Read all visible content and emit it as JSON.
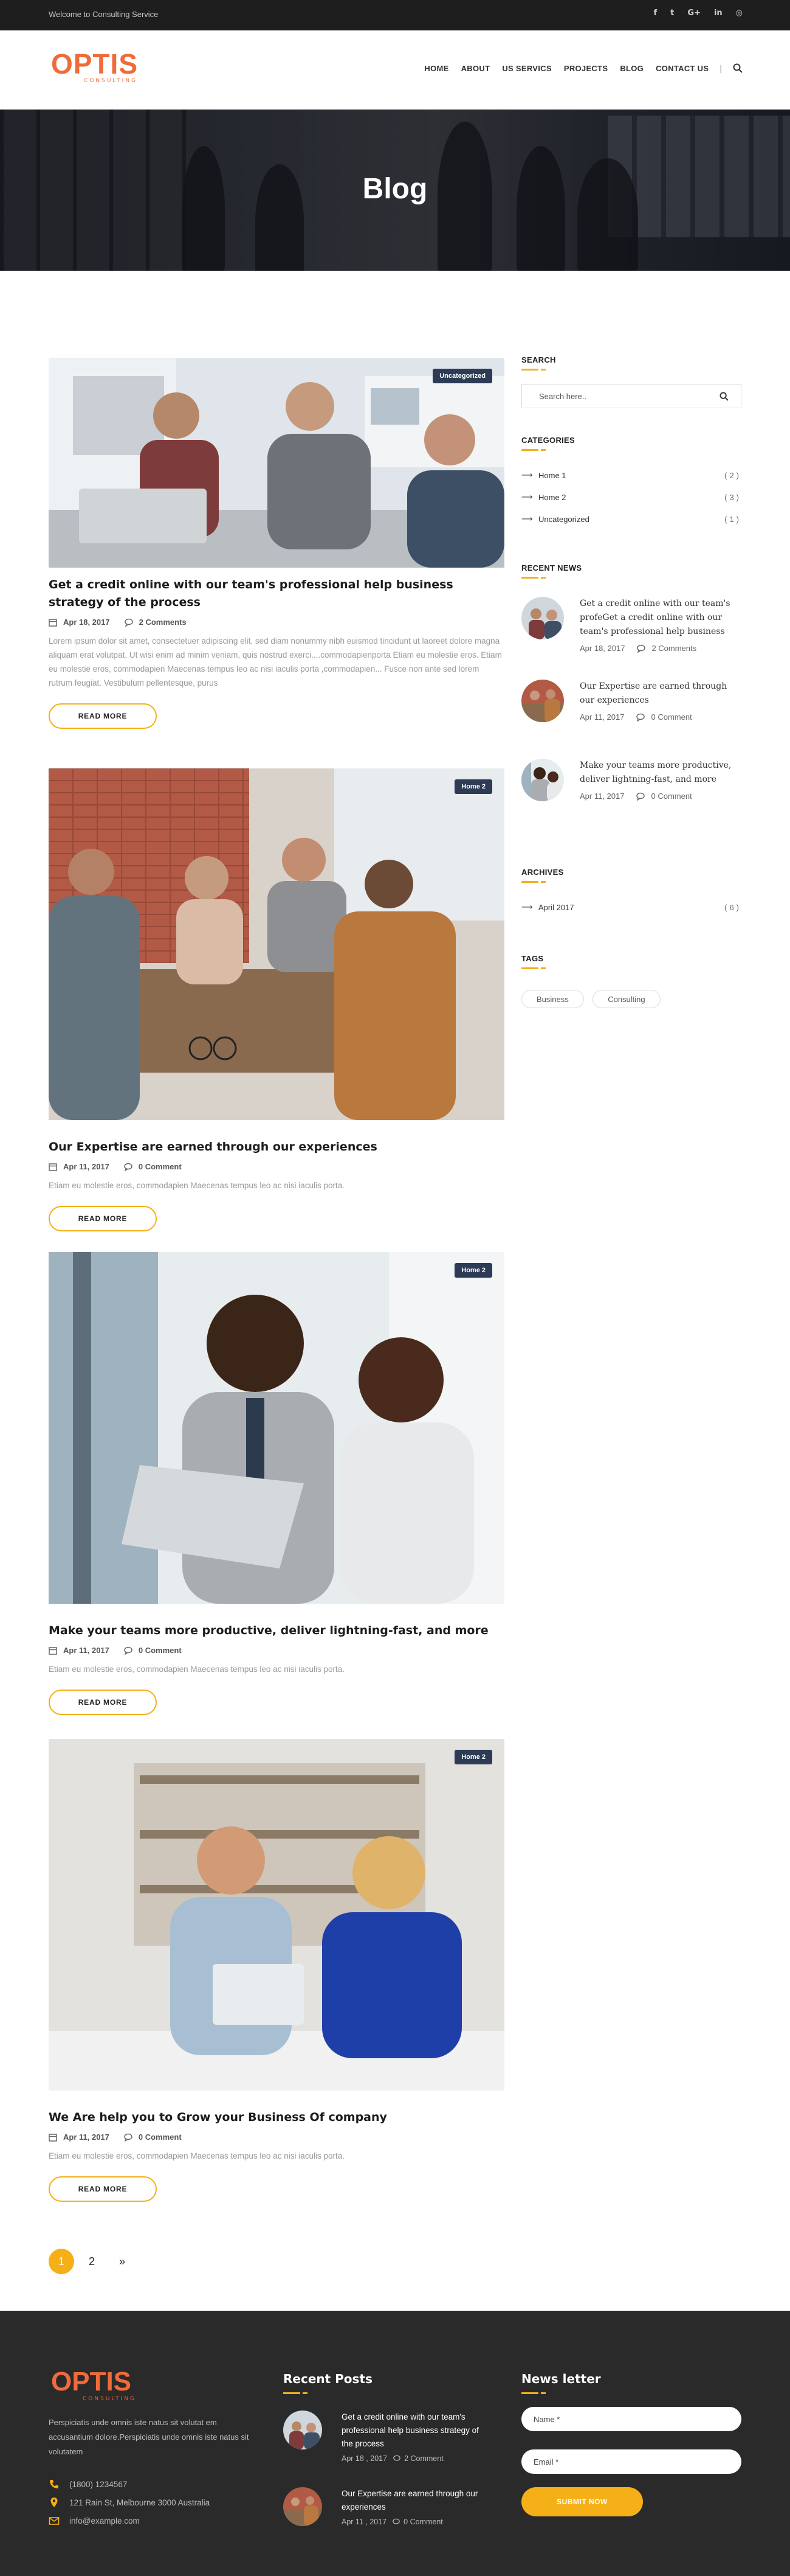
{
  "topbar": {
    "welcome": "Welcome to Consulting Service",
    "socials": [
      {
        "icon": "facebook-icon",
        "glyph": "f"
      },
      {
        "icon": "twitter-icon",
        "glyph": "t"
      },
      {
        "icon": "google-plus-icon",
        "glyph": "G+"
      },
      {
        "icon": "linkedin-icon",
        "glyph": "in"
      },
      {
        "icon": "instagram-icon",
        "glyph": "◎"
      }
    ]
  },
  "header": {
    "logo": {
      "mark": "OPTIS",
      "sub": "CONSULTING"
    },
    "nav": [
      "HOME",
      "ABOUT",
      "US SERVICS",
      "PROJECTS",
      "BLOG",
      "CONTACT US"
    ],
    "nav_separator": "|"
  },
  "hero": {
    "title": "Blog"
  },
  "posts": [
    {
      "badge": "Uncategorized",
      "title": "Get a credit online with our team's professional help business strategy of the process",
      "date": "Apr 18, 2017",
      "comments": "2 Comments",
      "excerpt": "Lorem ipsum dolor sit amet, consectetuer adipiscing elit, sed diam nonummy nibh euismod tincidunt ut laoreet dolore magna aliquam erat volutpat. Ut wisi enim ad minim veniam, quis nostrud exerci....commodapienporta Etiam eu molestie eros. Etiam eu molestie eros, commodapien Maecenas tempus leo ac nisi iaculis porta ,commodapien... Fusce non ante sed lorem rutrum feugiat. Vestibulum pellentesque, purus",
      "more": "READ MORE"
    },
    {
      "badge": "Home 2",
      "title": "Our Expertise are earned through our experiences",
      "date": "Apr 11, 2017",
      "comments": "0 Comment",
      "excerpt": "Etiam eu molestie eros, commodapien Maecenas tempus leo ac nisi iaculis porta.",
      "more": "READ MORE"
    },
    {
      "badge": "Home 2",
      "title": "Make your teams more productive, deliver lightning-fast, and more",
      "date": "Apr 11, 2017",
      "comments": "0 Comment",
      "excerpt": "Etiam eu molestie eros, commodapien Maecenas tempus leo ac nisi iaculis porta.",
      "more": "READ MORE"
    },
    {
      "badge": "Home 2",
      "title": "We Are help you to Grow your Business Of company",
      "date": "Apr 11, 2017",
      "comments": "0 Comment",
      "excerpt": "Etiam eu molestie eros, commodapien Maecenas tempus leo ac nisi iaculis porta.",
      "more": "READ MORE"
    }
  ],
  "sidebar": {
    "search": {
      "heading": "SEARCH",
      "placeholder": "Search here.."
    },
    "categories": {
      "heading": "CATEGORIES",
      "items": [
        {
          "label": "Home 1",
          "count": "(2)"
        },
        {
          "label": "Home 2",
          "count": "(3)"
        },
        {
          "label": "Uncategorized",
          "count": "(1)"
        }
      ]
    },
    "recent_news": {
      "heading": "RECENT NEWS",
      "items": [
        {
          "title": "Get a credit online with our team's profeGet a credit online with our team's professional help business",
          "date": "Apr 18, 2017",
          "comments": "2 Comments"
        },
        {
          "title": "Our Expertise are earned through our experiences",
          "date": "Apr 11, 2017",
          "comments": "0 Comment"
        },
        {
          "title": "Make your teams more productive, deliver lightning-fast, and more",
          "date": "Apr 11, 2017",
          "comments": "0 Comment"
        }
      ]
    },
    "archives": {
      "heading": "ARCHIVES",
      "items": [
        {
          "label": "April 2017",
          "count": "(6)"
        }
      ]
    },
    "tags": {
      "heading": "TAGS",
      "items": [
        "Business",
        "Consulting"
      ]
    }
  },
  "pagination": {
    "pages": [
      "1",
      "2"
    ],
    "next": "»",
    "active": "1"
  },
  "footer": {
    "logo": {
      "mark": "OPTIS",
      "sub": "CONSULTING"
    },
    "about": "Perspiciatis unde omnis iste natus sit volutat em accusantium dolore.Perspiciatis unde omnis iste natus sit volutatem",
    "contacts": [
      {
        "icon": "phone-icon",
        "text": "(1800) 1234567"
      },
      {
        "icon": "map-pin-icon",
        "text": "121 Rain St, Melbourne 3000 Australia"
      },
      {
        "icon": "mail-icon",
        "text": "info@example.com"
      }
    ],
    "recent_posts": {
      "heading": "Recent Posts",
      "items": [
        {
          "title": "Get a credit online with our team's professional help business strategy of the process",
          "date": "Apr 18 , 2017",
          "comments": "2 Comment"
        },
        {
          "title": "Our Expertise are earned through our experiences",
          "date": "Apr 11 , 2017",
          "comments": "0 Comment"
        }
      ]
    },
    "newsletter": {
      "heading": "News letter",
      "name_placeholder": "Name *",
      "email_placeholder": "Email *",
      "submit": "SUBMIT NOW"
    }
  },
  "colors": {
    "accent": "#f5b018",
    "logo": "#f06b3a",
    "badge": "#2d3b55",
    "topbar": "#1e1e1e",
    "footer": "#2a2a2a"
  }
}
